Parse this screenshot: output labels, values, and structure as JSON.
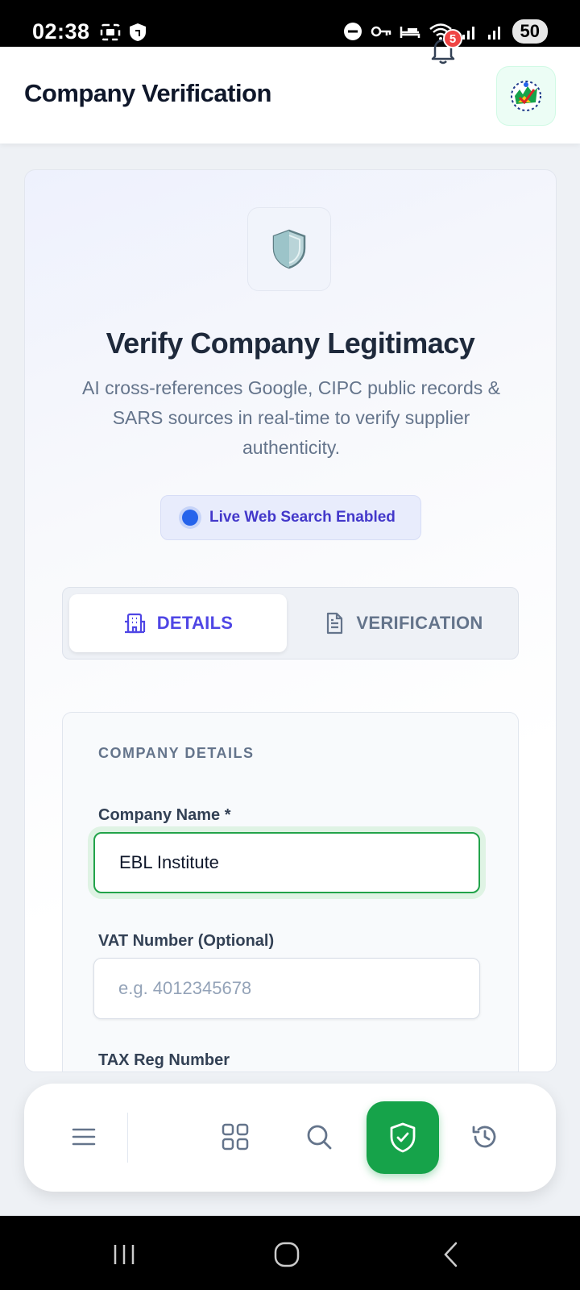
{
  "status_bar": {
    "time": "02:38",
    "battery": "50",
    "icons": [
      "screenshot-icon",
      "vpn-shield-icon",
      "dnd-icon",
      "key-icon",
      "bed-icon",
      "wifi-icon",
      "signal-icon",
      "signal-icon"
    ]
  },
  "header": {
    "title": "Company Verification",
    "notification_count": "5",
    "logo": "sa-government-logo"
  },
  "hero": {
    "icon": "shield-icon",
    "title": "Verify Company Legitimacy",
    "description": "AI cross-references Google, CIPC public records & SARS sources in real-time to verify supplier authenticity.",
    "live_pill": "Live Web Search Enabled"
  },
  "tabs": [
    {
      "label": "DETAILS",
      "icon": "building-icon",
      "active": true
    },
    {
      "label": "VERIFICATION",
      "icon": "document-icon",
      "active": false
    }
  ],
  "form": {
    "section_label": "COMPANY DETAILS",
    "company_name_label": "Company Name *",
    "company_name_value": "EBL Institute",
    "vat_label": "VAT Number (Optional)",
    "vat_placeholder": "e.g. 4012345678",
    "tax_label": "TAX Reg Number"
  },
  "bottom_nav": {
    "items": [
      "menu-icon",
      "grid-icon",
      "search-icon",
      "shield-check-icon",
      "history-icon"
    ],
    "active": "shield-check-icon"
  },
  "colors": {
    "accent": "#4f46e5",
    "success": "#16a34a",
    "badge": "#ef4444"
  }
}
